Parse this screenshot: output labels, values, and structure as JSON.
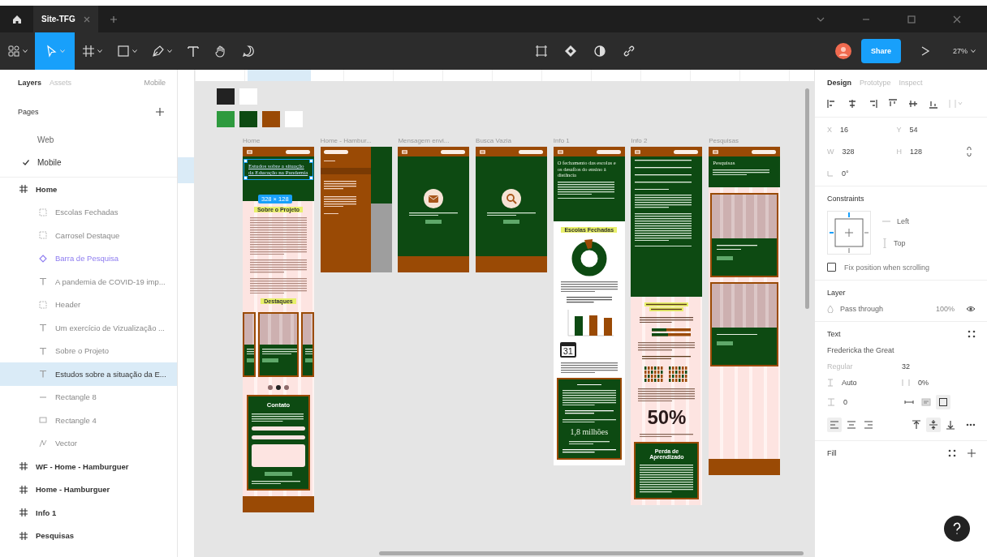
{
  "window": {
    "title": "Site-TFG"
  },
  "toolbar": {
    "tools": [
      {
        "kind": "main-menu",
        "selected": false
      },
      {
        "kind": "move",
        "selected": true
      },
      {
        "kind": "frame",
        "selected": false
      },
      {
        "kind": "rectangle",
        "selected": false
      },
      {
        "kind": "pen",
        "selected": false
      },
      {
        "kind": "text",
        "selected": false
      },
      {
        "kind": "hand",
        "selected": false
      },
      {
        "kind": "comment",
        "selected": false
      }
    ],
    "share": "Share",
    "zoom": "27%"
  },
  "left_panel": {
    "tabs": [
      {
        "label": "Layers",
        "selected": true
      },
      {
        "label": "Assets",
        "selected": false
      }
    ],
    "page_menu": "Mobile",
    "pages_title": "Pages",
    "pages": [
      {
        "label": "Web",
        "selected": false
      },
      {
        "label": "Mobile",
        "selected": true
      }
    ],
    "layers": [
      {
        "name": "Home",
        "kind": "frame",
        "selected": false,
        "children": [
          {
            "name": "Escolas Fechadas",
            "kind": "group",
            "selected": false
          },
          {
            "name": "Carrosel Destaque",
            "kind": "group",
            "selected": false
          },
          {
            "name": "Barra de Pesquisa",
            "kind": "component",
            "selected": false
          },
          {
            "name": "A pandemia de COVID-19 imp...",
            "kind": "text",
            "selected": false
          },
          {
            "name": "Header",
            "kind": "group",
            "selected": false
          },
          {
            "name": "Um exercício de Vizualização ...",
            "kind": "text",
            "selected": false
          },
          {
            "name": "Sobre o Projeto",
            "kind": "text",
            "selected": false
          },
          {
            "name": "Estudos sobre a situação da E...",
            "kind": "text",
            "selected": true
          },
          {
            "name": "Rectangle 8",
            "kind": "line",
            "selected": false
          },
          {
            "name": "Rectangle 4",
            "kind": "rectangle",
            "selected": false
          },
          {
            "name": "Vector",
            "kind": "vector",
            "selected": false
          }
        ]
      },
      {
        "name": "WF - Home - Hamburguer",
        "kind": "frame",
        "selected": false
      },
      {
        "name": "Home - Hamburguer",
        "kind": "frame",
        "selected": false
      },
      {
        "name": "Info 1",
        "kind": "frame",
        "selected": false
      },
      {
        "name": "Pesquisas",
        "kind": "frame",
        "selected": false
      }
    ]
  },
  "canvas": {
    "color_styles": [
      {
        "swatches": [
          {
            "color": "#222222"
          },
          {
            "color": "#ffffff"
          }
        ]
      },
      {
        "swatches": [
          {
            "color": "#2e9a3e"
          },
          {
            "color": "#0d4a12"
          },
          {
            "color": "#9a4a05"
          },
          {
            "color": "#ffffff"
          }
        ]
      }
    ],
    "frames": [
      {
        "label": "Home",
        "kind": "home",
        "heading": "Estudos sobre a situação da Educação na Pandemia",
        "selection_size": "328 × 128",
        "texts": [
          "Sobre o Projeto",
          "Destaques",
          "Contato"
        ],
        "dots": [
          {
            "selected": false
          },
          {
            "selected": true
          },
          {
            "selected": false
          }
        ]
      },
      {
        "label": "Home - Hambur...",
        "kind": "menu"
      },
      {
        "label": "Mensagem envi...",
        "kind": "message"
      },
      {
        "label": "Busca Vazia",
        "kind": "search"
      },
      {
        "label": "Info 1",
        "kind": "info1",
        "heading": "O fechamento das escolas e os desafios do ensino à distância",
        "texts": [
          "Escolas Fechadas",
          "31",
          "1,8 milhões"
        ]
      },
      {
        "label": "Info 2",
        "kind": "info2",
        "texts": [
          "50%",
          "Perda de Aprendizado"
        ]
      },
      {
        "label": "Pesquisas",
        "kind": "surveys",
        "heading": "Pesquisas"
      }
    ]
  },
  "right_panel": {
    "tabs": [
      {
        "label": "Design",
        "selected": true
      },
      {
        "label": "Prototype",
        "selected": false
      },
      {
        "label": "Inspect",
        "selected": false
      }
    ],
    "fields": [
      {
        "label": "X",
        "value": "16"
      },
      {
        "label": "Y",
        "value": "54"
      },
      {
        "label": "W",
        "value": "328"
      },
      {
        "label": "H",
        "value": "128"
      }
    ],
    "rotation": "0°",
    "constraints": {
      "title": "Constraints",
      "horizontal": "Left",
      "vertical": "Top",
      "fix_label": "Fix position when scrolling",
      "fix_checked": false
    },
    "layer": {
      "title": "Layer",
      "blend": "Pass through",
      "opacity": "100%"
    },
    "text": {
      "title": "Text",
      "font": "Fredericka the Great",
      "style": "Regular",
      "size": "32",
      "line_height": "Auto",
      "letter_spacing": "0%",
      "paragraph_spacing": "0",
      "resize": [
        {
          "kind": "auto-width",
          "selected": false
        },
        {
          "kind": "auto-height",
          "selected": false
        },
        {
          "kind": "fixed",
          "selected": true
        }
      ],
      "align_h": [
        {
          "kind": "left",
          "selected": true
        },
        {
          "kind": "center",
          "selected": false
        },
        {
          "kind": "right",
          "selected": false
        }
      ],
      "align_v": [
        {
          "kind": "top",
          "selected": false
        },
        {
          "kind": "middle",
          "selected": true
        },
        {
          "kind": "bottom",
          "selected": false
        }
      ]
    },
    "fill": {
      "title": "Fill"
    }
  }
}
